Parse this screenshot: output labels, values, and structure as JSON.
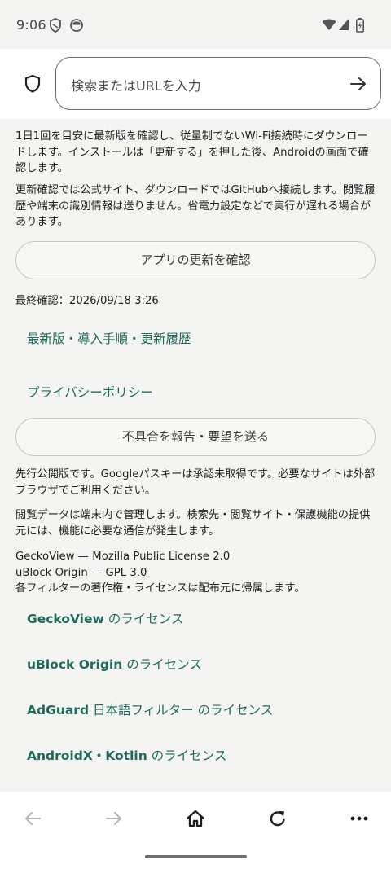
{
  "status_bar": {
    "time": "9:06"
  },
  "header": {
    "search_placeholder": "検索またはURLを入力"
  },
  "update": {
    "paragraph1": "1日1回を目安に最新版を確認し、従量制でないWi-Fi接続時にダウンロードします。インストールは「更新する」を押した後、Androidの画面で確認します。",
    "paragraph2": "更新確認では公式サイト、ダウンロードではGitHubへ接続します。閲覧履歴や端末の識別情報は送りません。省電力設定などで実行が遅れる場合があります。",
    "check_button": "アプリの更新を確認",
    "last_checked": "最終確認：2026/09/18 3:26"
  },
  "links": {
    "latest": "最新版・導入手順・更新履歴",
    "privacy": "プライバシーポリシー"
  },
  "report_button": "不具合を報告・要望を送る",
  "notes": {
    "preview": "先行公開版です。Googleパスキーは承認未取得です。必要なサイトは外部ブラウザでご利用ください。",
    "data": "閲覧データは端末内で管理します。検索先・閲覧サイト・保護機能の提供元には、機能に必要な通信が発生します。",
    "licenses_line1": "GeckoView — Mozilla Public License 2.0",
    "licenses_line2": "uBlock Origin — GPL 3.0",
    "licenses_line3": "各フィルターの著作権・ライセンスは配布元に帰属します。"
  },
  "license_links": [
    {
      "name": "GeckoView",
      "suffix": " のライセンス"
    },
    {
      "name": "uBlock Origin",
      "suffix": " のライセンス"
    },
    {
      "name": "AdGuard",
      "suffix": " 日本語フィルター のライセンス"
    },
    {
      "name": "AndroidX・Kotlin",
      "suffix": " のライセンス"
    }
  ],
  "toolbar": {
    "icons": [
      "back-icon",
      "forward-icon",
      "home-icon",
      "reload-icon",
      "more-icon"
    ]
  },
  "colors": {
    "link": "#1e6b5c",
    "background": "#f4f5f2"
  }
}
